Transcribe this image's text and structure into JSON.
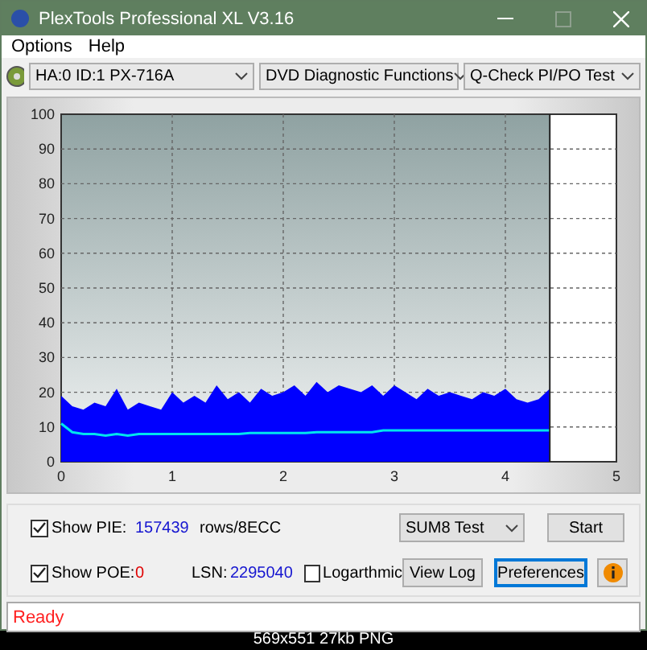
{
  "window": {
    "title": "PlexTools Professional XL V3.16"
  },
  "menu": [
    "Options",
    "Help"
  ],
  "toolbar": {
    "drive": "HA:0 ID:1  PX-716A",
    "function": "DVD Diagnostic Functions",
    "test": "Q-Check PI/PO Test"
  },
  "chart": {
    "chart_data": {
      "type": "area",
      "grid": true,
      "bands": [
        {
          "axis": "x",
          "from": 4.4,
          "to": 5,
          "color": "#ffffff"
        }
      ],
      "ref_lines": [
        {
          "axis": "x",
          "value": 4.4,
          "color": "#222222"
        }
      ],
      "xlim": [
        0,
        5
      ],
      "ylim": [
        0,
        100
      ],
      "xticks": [
        0,
        1,
        2,
        3,
        4,
        5
      ],
      "yticks": [
        0,
        10,
        20,
        30,
        40,
        50,
        60,
        70,
        80,
        90,
        100
      ],
      "x": [
        0,
        0.1,
        0.2,
        0.3,
        0.4,
        0.5,
        0.6,
        0.7,
        0.8,
        0.9,
        1,
        1.1,
        1.2,
        1.3,
        1.4,
        1.5,
        1.6,
        1.7,
        1.8,
        1.9,
        2,
        2.1,
        2.2,
        2.3,
        2.4,
        2.5,
        2.6,
        2.7,
        2.8,
        2.9,
        3,
        3.1,
        3.2,
        3.3,
        3.4,
        3.5,
        3.6,
        3.7,
        3.8,
        3.9,
        4,
        4.1,
        4.2,
        4.3,
        4.4
      ],
      "series": [
        {
          "color": "#0000ff",
          "values": [
            19,
            16,
            15,
            17,
            16,
            21,
            15,
            17,
            16,
            15,
            20,
            17,
            19,
            17,
            22,
            18,
            20,
            17,
            21,
            19,
            20,
            22,
            19,
            23,
            20,
            22,
            21,
            20,
            22,
            19,
            22,
            20,
            18,
            21,
            19,
            20,
            19,
            18,
            20,
            19,
            21,
            18,
            17,
            18,
            21
          ]
        },
        {
          "color": "#00e5ee",
          "type": "line",
          "values": [
            11,
            8.5,
            8,
            8,
            7.5,
            8,
            7.5,
            8,
            8,
            8,
            8,
            8,
            8,
            8,
            8,
            8,
            8,
            8.3,
            8.3,
            8.3,
            8.3,
            8.3,
            8.3,
            8.5,
            8.5,
            8.5,
            8.5,
            8.5,
            8.5,
            9,
            9,
            9,
            9,
            9,
            9,
            9,
            9,
            9,
            9,
            9,
            9,
            9,
            9,
            9,
            9
          ]
        }
      ]
    }
  },
  "controls": {
    "show_pie": {
      "label": "Show PIE:",
      "checked": true,
      "value": "157439"
    },
    "unit": "rows/8ECC",
    "show_poe": {
      "label": "Show POE:",
      "checked": true,
      "value": "0"
    },
    "lsn_label": "LSN:",
    "lsn": "2295040",
    "logarithmic": {
      "label": "Logarthmic",
      "checked": false
    },
    "mode": "SUM8 Test",
    "buttons": [
      {
        "label": "Start",
        "focused": false
      },
      {
        "label": "View Log",
        "focused": false
      },
      {
        "label": "Preferences",
        "focused": true
      }
    ]
  },
  "status_bar": "Ready",
  "caption": "569x551 27kb PNG"
}
